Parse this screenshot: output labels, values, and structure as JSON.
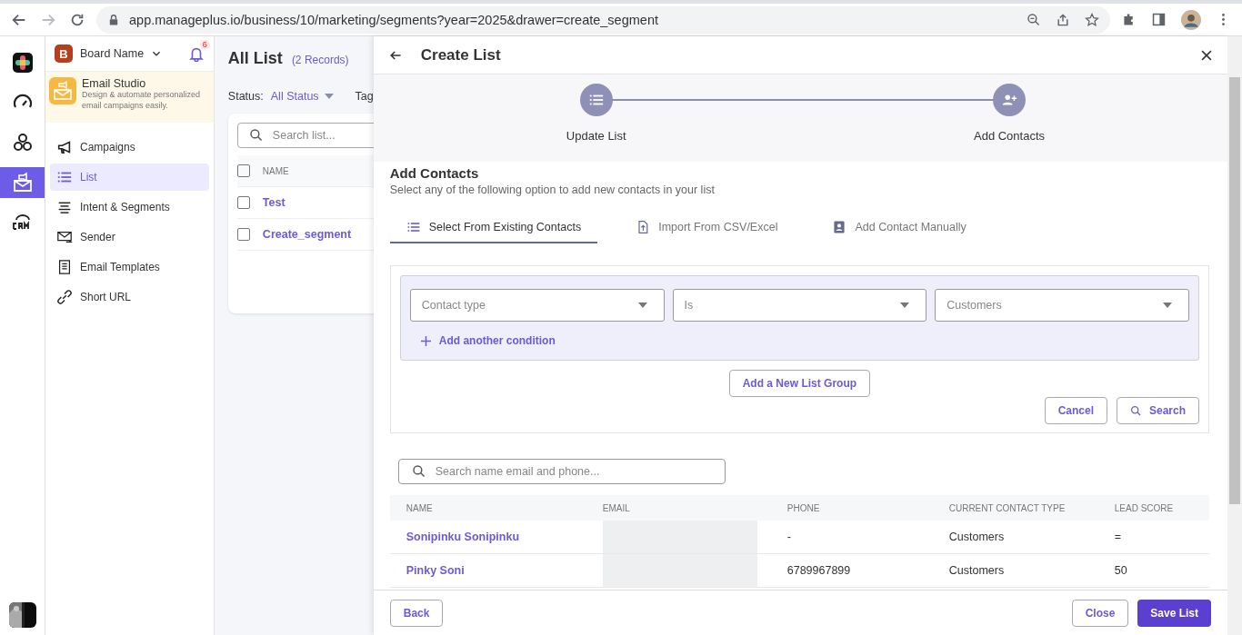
{
  "browser": {
    "url": "app.manageplus.io/business/10/marketing/segments?year=2025&drawer=create_segment"
  },
  "rail": {
    "items": [
      {
        "kind": "logo",
        "selected": false
      },
      {
        "kind": "gauge",
        "selected": false
      },
      {
        "kind": "circles",
        "selected": false
      },
      {
        "kind": "email",
        "selected": true
      },
      {
        "kind": "crm",
        "selected": false
      }
    ]
  },
  "sidebar": {
    "board_initial": "B",
    "board_name": "Board Name",
    "notification_count": "6",
    "app": {
      "title": "Email Studio",
      "description": "Design & automate personalized email campaigns easily."
    },
    "items": [
      {
        "kind": "megaphone",
        "label": "Campaigns",
        "selected": false
      },
      {
        "kind": "list",
        "label": "List",
        "selected": true
      },
      {
        "kind": "lines",
        "label": "Intent & Segments",
        "selected": false
      },
      {
        "kind": "envelope",
        "label": "Sender",
        "selected": false
      },
      {
        "kind": "doc",
        "label": "Email Templates",
        "selected": false
      },
      {
        "kind": "link",
        "label": "Short URL",
        "selected": false
      }
    ]
  },
  "main": {
    "title": "All List",
    "record_count": "(2 Records)",
    "status_label": "Status:",
    "status_value": "All Status",
    "tags_label": "Tag",
    "search": {
      "placeholder": "Search list..."
    },
    "column": "NAME",
    "header_checked": false,
    "rows": [
      {
        "name": "Test",
        "checked": false
      },
      {
        "name": "Create_segment",
        "checked": false
      }
    ]
  },
  "drawer": {
    "title": "Create List",
    "steps": [
      {
        "kind": "list",
        "label": "Update List"
      },
      {
        "kind": "person",
        "label": "Add Contacts"
      }
    ],
    "section_title": "Add Contacts",
    "section_subtitle": "Select any of the following option to add new contacts in your list",
    "tabs": [
      {
        "kind": "list",
        "label": "Select From Existing Contacts",
        "selected": true
      },
      {
        "kind": "upload",
        "label": "Import From CSV/Excel",
        "selected": false
      },
      {
        "kind": "contact",
        "label": "Add Contact Manually",
        "selected": false
      }
    ],
    "conditions": [
      {
        "placeholder": "Contact type"
      },
      {
        "placeholder": "Is"
      },
      {
        "placeholder": "Customers"
      }
    ],
    "add_condition": "Add another condition",
    "add_group": "Add a New List Group",
    "cancel": "Cancel",
    "search": "Search",
    "contact_search": {
      "placeholder": "Search name email and phone..."
    },
    "table": {
      "columns": [
        "NAME",
        "EMAIL",
        "PHONE",
        "CURRENT CONTACT TYPE",
        "LEAD SCORE"
      ],
      "rows": [
        {
          "name": "Sonipinku Sonipinku",
          "phone": "-",
          "type": "Customers",
          "score": "="
        },
        {
          "name": "Pinky Soni",
          "phone": "6789967899",
          "type": "Customers",
          "score": "50"
        }
      ]
    },
    "back": "Back",
    "close": "Close",
    "save": "Save List"
  }
}
